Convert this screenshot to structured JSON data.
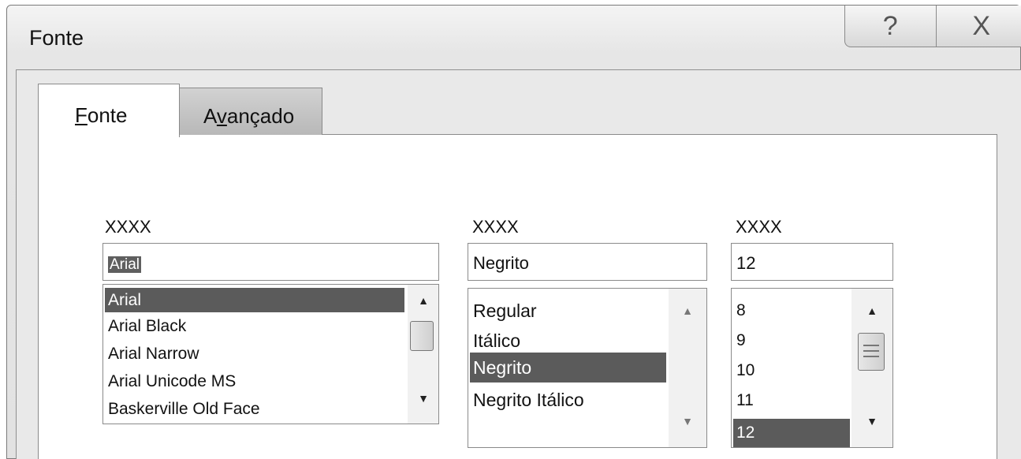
{
  "window": {
    "title": "Fonte",
    "help_icon": "?",
    "close_icon": "X"
  },
  "tabs": [
    {
      "label": "Fonte",
      "mnemonic": "F",
      "rest": "onte",
      "active": true
    },
    {
      "label": "Avançado",
      "prefix": "A",
      "mnemonic": "v",
      "rest": "ançado",
      "active": false
    }
  ],
  "font_family": {
    "label": "XXXX",
    "value": "Arial",
    "items": [
      "Arial",
      "Arial Black",
      "Arial Narrow",
      "Arial Unicode MS",
      "Baskerville Old Face"
    ],
    "selected": "Arial"
  },
  "font_style": {
    "label": "XXXX",
    "value": "Negrito",
    "items": [
      "Regular",
      "Itálico",
      "Negrito",
      "Negrito Itálico"
    ],
    "selected": "Negrito"
  },
  "font_size": {
    "label": "XXXX",
    "value": "12",
    "items": [
      "8",
      "9",
      "10",
      "11",
      "12"
    ],
    "selected": "12"
  },
  "icons": {
    "scroll_up": "▲",
    "scroll_down": "▼"
  }
}
